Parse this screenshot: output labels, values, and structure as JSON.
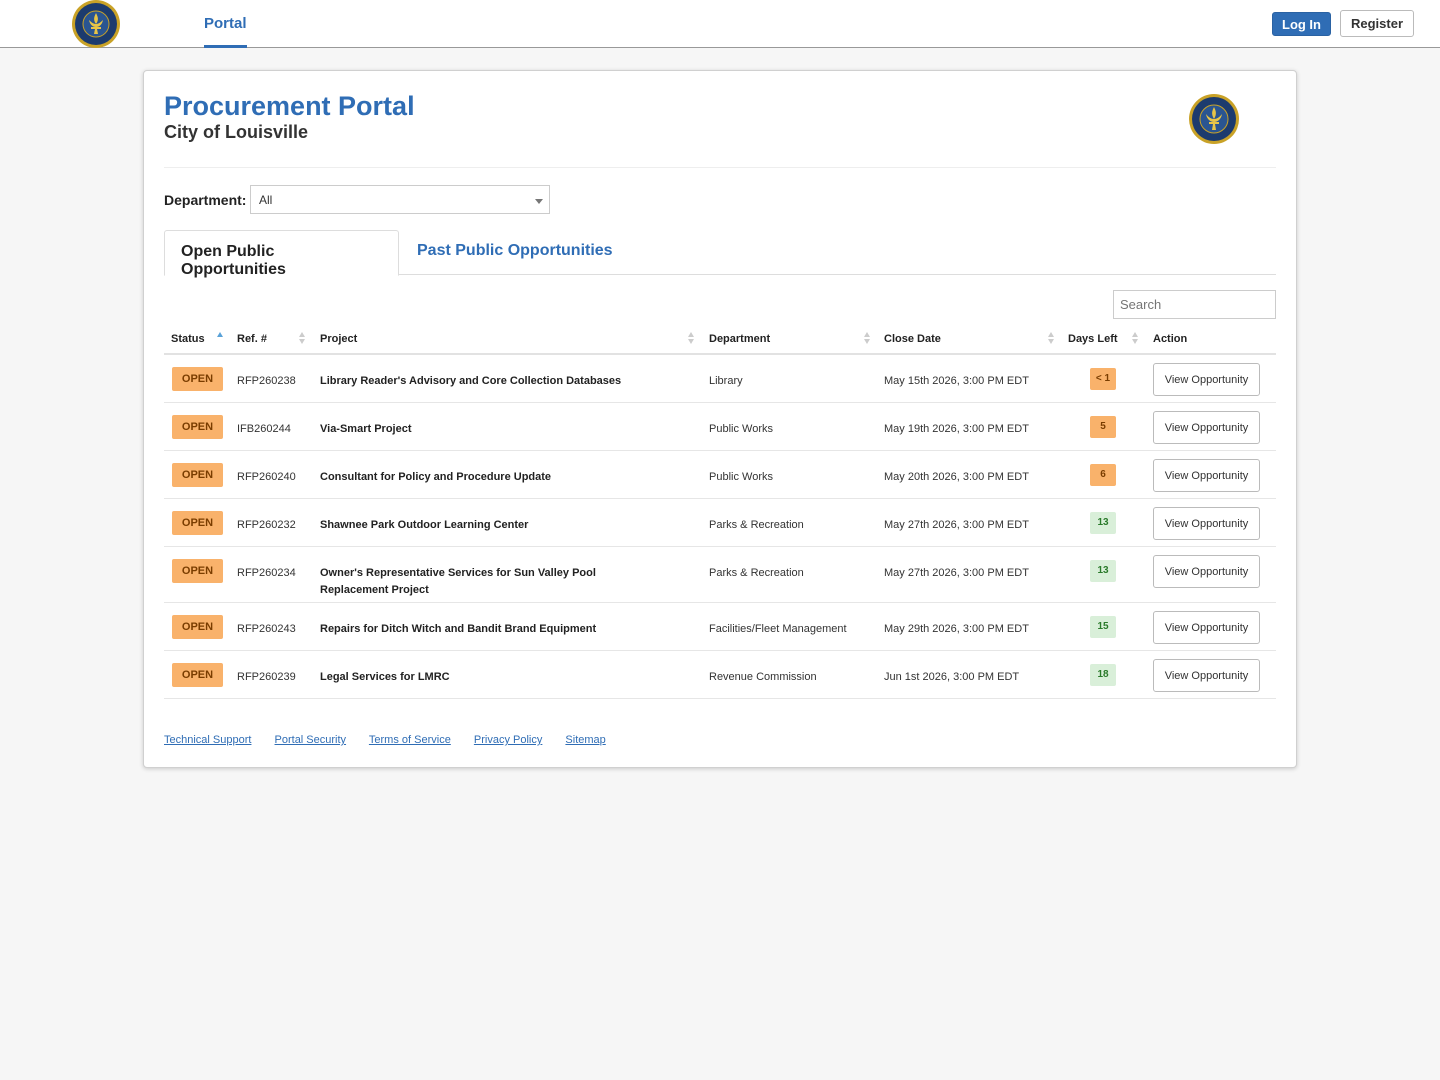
{
  "navbar": {
    "tab_label": "Portal",
    "login_label": "Log In",
    "register_label": "Register"
  },
  "header": {
    "title": "Procurement Portal",
    "subtitle": "City of Louisville"
  },
  "filter": {
    "label": "Department:",
    "selected": "All"
  },
  "tabs": [
    {
      "label": "Open Public Opportunities",
      "active": true
    },
    {
      "label": "Past Public Opportunities",
      "active": false
    }
  ],
  "search": {
    "placeholder": "Search"
  },
  "table": {
    "columns": [
      "Status",
      "Ref. #",
      "Project",
      "Department",
      "Close Date",
      "Days Left",
      "Action"
    ],
    "rows": [
      {
        "status": "OPEN",
        "ref": "RFP260238",
        "project": "Library Reader's Advisory and Core Collection Databases",
        "department": "Library",
        "close_date": "May 15th 2026, 3:00 PM EDT",
        "days_left": "< 1",
        "days_level": "warn",
        "action": "View Opportunity"
      },
      {
        "status": "OPEN",
        "ref": "IFB260244",
        "project": "Via-Smart Project",
        "department": "Public Works",
        "close_date": "May 19th 2026, 3:00 PM EDT",
        "days_left": "5",
        "days_level": "warn",
        "action": "View Opportunity"
      },
      {
        "status": "OPEN",
        "ref": "RFP260240",
        "project": "Consultant for Policy and Procedure Update",
        "department": "Public Works",
        "close_date": "May 20th 2026, 3:00 PM EDT",
        "days_left": "6",
        "days_level": "warn",
        "action": "View Opportunity"
      },
      {
        "status": "OPEN",
        "ref": "RFP260232",
        "project": "Shawnee Park Outdoor Learning Center",
        "department": "Parks & Recreation",
        "close_date": "May 27th 2026, 3:00 PM EDT",
        "days_left": "13",
        "days_level": "ok",
        "action": "View Opportunity"
      },
      {
        "status": "OPEN",
        "ref": "RFP260234",
        "project": "Owner's Representative Services for Sun Valley Pool Replacement Project",
        "department": "Parks & Recreation",
        "close_date": "May 27th 2026, 3:00 PM EDT",
        "days_left": "13",
        "days_level": "ok",
        "action": "View Opportunity"
      },
      {
        "status": "OPEN",
        "ref": "RFP260243",
        "project": "Repairs for Ditch Witch and Bandit Brand Equipment",
        "department": "Facilities/Fleet Management",
        "close_date": "May 29th 2026, 3:00 PM EDT",
        "days_left": "15",
        "days_level": "ok",
        "action": "View Opportunity"
      },
      {
        "status": "OPEN",
        "ref": "RFP260239",
        "project": "Legal Services for LMRC",
        "department": "Revenue Commission",
        "close_date": "Jun 1st 2026, 3:00 PM EDT",
        "days_left": "18",
        "days_level": "ok",
        "action": "View Opportunity"
      }
    ]
  },
  "footer": {
    "links": [
      "Technical Support",
      "Portal Security",
      "Terms of Service",
      "Privacy Policy",
      "Sitemap"
    ]
  },
  "colors": {
    "brand_blue": "#2f6db5",
    "badge_orange": "#f9b26b",
    "badge_green": "#d9efd9",
    "seal_navy": "#1c3b6e",
    "seal_gold": "#c9a227"
  },
  "icons": {
    "logo": "louisville-seal-icon",
    "sort": "sort-arrows-icon",
    "dropdown": "chevron-down-icon"
  }
}
